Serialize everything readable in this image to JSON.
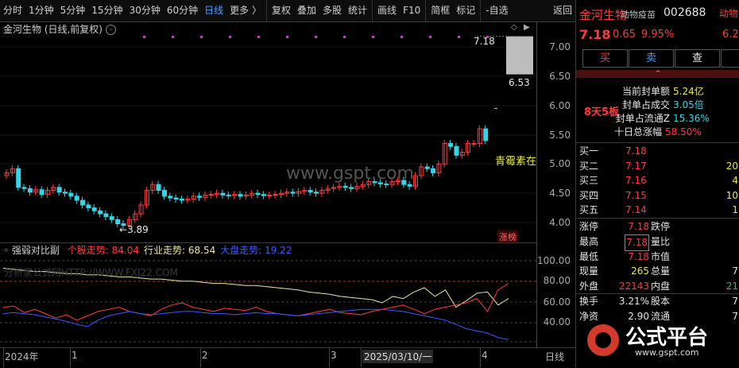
{
  "toolbar": {
    "items": [
      "分时",
      "1分钟",
      "5分钟",
      "15分钟",
      "30分钟",
      "60分钟",
      "日线",
      "更多 〉",
      "复权",
      "叠加",
      "多股",
      "统计",
      "画线",
      "F10",
      "简框",
      "标记",
      "-自选",
      "返回"
    ],
    "active_index": 6
  },
  "chart": {
    "legend": "金河生物 (日线,前复权)",
    "price_axis": [
      "7.00",
      "6.50",
      "6.00",
      "5.50",
      "5.00",
      "4.50",
      "4.00"
    ],
    "high_label": "7.18",
    "gap_label": "6.53",
    "low_label": "3.89",
    "watermark": "www.gspt.com",
    "annotation": "青霉素在",
    "zhangting_tag": "涨榜"
  },
  "indicator": {
    "name": "强弱对比副",
    "items": [
      {
        "label": "个股走势",
        "value": "84.04",
        "color": "#ff3b3b"
      },
      {
        "label": "行业走势",
        "value": "68.54",
        "color": "#e8e8a0"
      },
      {
        "label": "大盘走势",
        "value": "19.22",
        "color": "#3a5bff"
      }
    ],
    "axis": [
      "100.00",
      "80.00",
      "60.00",
      "40.00"
    ],
    "watermark": "分析家公式网HTTP://WWW.FXJ22.COM"
  },
  "x_axis": {
    "labels": [
      {
        "text": "2024年"
      },
      {
        "text": "1"
      },
      {
        "text": "2"
      },
      {
        "text": "3"
      },
      {
        "text": "2025/03/10/一"
      },
      {
        "text": "4"
      }
    ],
    "period": "日线"
  },
  "quote": {
    "name": "金河生物",
    "sector": "动物疫苗",
    "code": "002688",
    "next_name": "动物",
    "price": "7.18",
    "change": "0.65",
    "pct": "9.95%",
    "side_pct": "6.2",
    "buttons": [
      "买",
      "卖",
      "查"
    ],
    "board_tag": "8天5板",
    "seal_stats": [
      {
        "label": "当前封单额",
        "value": "5.24亿"
      },
      {
        "label": "封单占成交",
        "value": "3.05倍"
      },
      {
        "label": "封单占流通Z",
        "value": "15.36%"
      },
      {
        "label": "十日总涨幅",
        "value": "58.50%"
      }
    ],
    "bids": [
      {
        "label": "买一",
        "price": "7.18",
        "vol": ""
      },
      {
        "label": "买二",
        "price": "7.17",
        "vol": "20"
      },
      {
        "label": "买三",
        "price": "7.16",
        "vol": "4"
      },
      {
        "label": "买四",
        "price": "7.15",
        "vol": "10"
      },
      {
        "label": "买五",
        "price": "7.14",
        "vol": "1"
      }
    ],
    "stats": [
      {
        "l1": "涨停",
        "v1": "7.18",
        "l2": "跌停",
        "v2": ""
      },
      {
        "l1": "最高",
        "v1": "7.18",
        "l2": "量比",
        "v2": ""
      },
      {
        "l1": "最低",
        "v1": "7.18",
        "l2": "市值",
        "v2": ""
      },
      {
        "l1": "现量",
        "v1": "265",
        "l2": "总量",
        "v2": "7"
      },
      {
        "l1": "外盘",
        "v1": "22143",
        "l2": "内盘",
        "v2": "21"
      },
      {
        "l1": "换手",
        "v1": "3.21%",
        "l2": "股本",
        "v2": "7"
      },
      {
        "l1": "净资",
        "v1": "2.90",
        "l2": "流通",
        "v2": "7"
      }
    ],
    "logo_text": "公式平台",
    "logo_url": "www.gspt.com"
  },
  "colors": {
    "up": "#ff3b3b",
    "down": "#33d6e6",
    "bg": "#000000",
    "accent": "#4a9cff"
  }
}
